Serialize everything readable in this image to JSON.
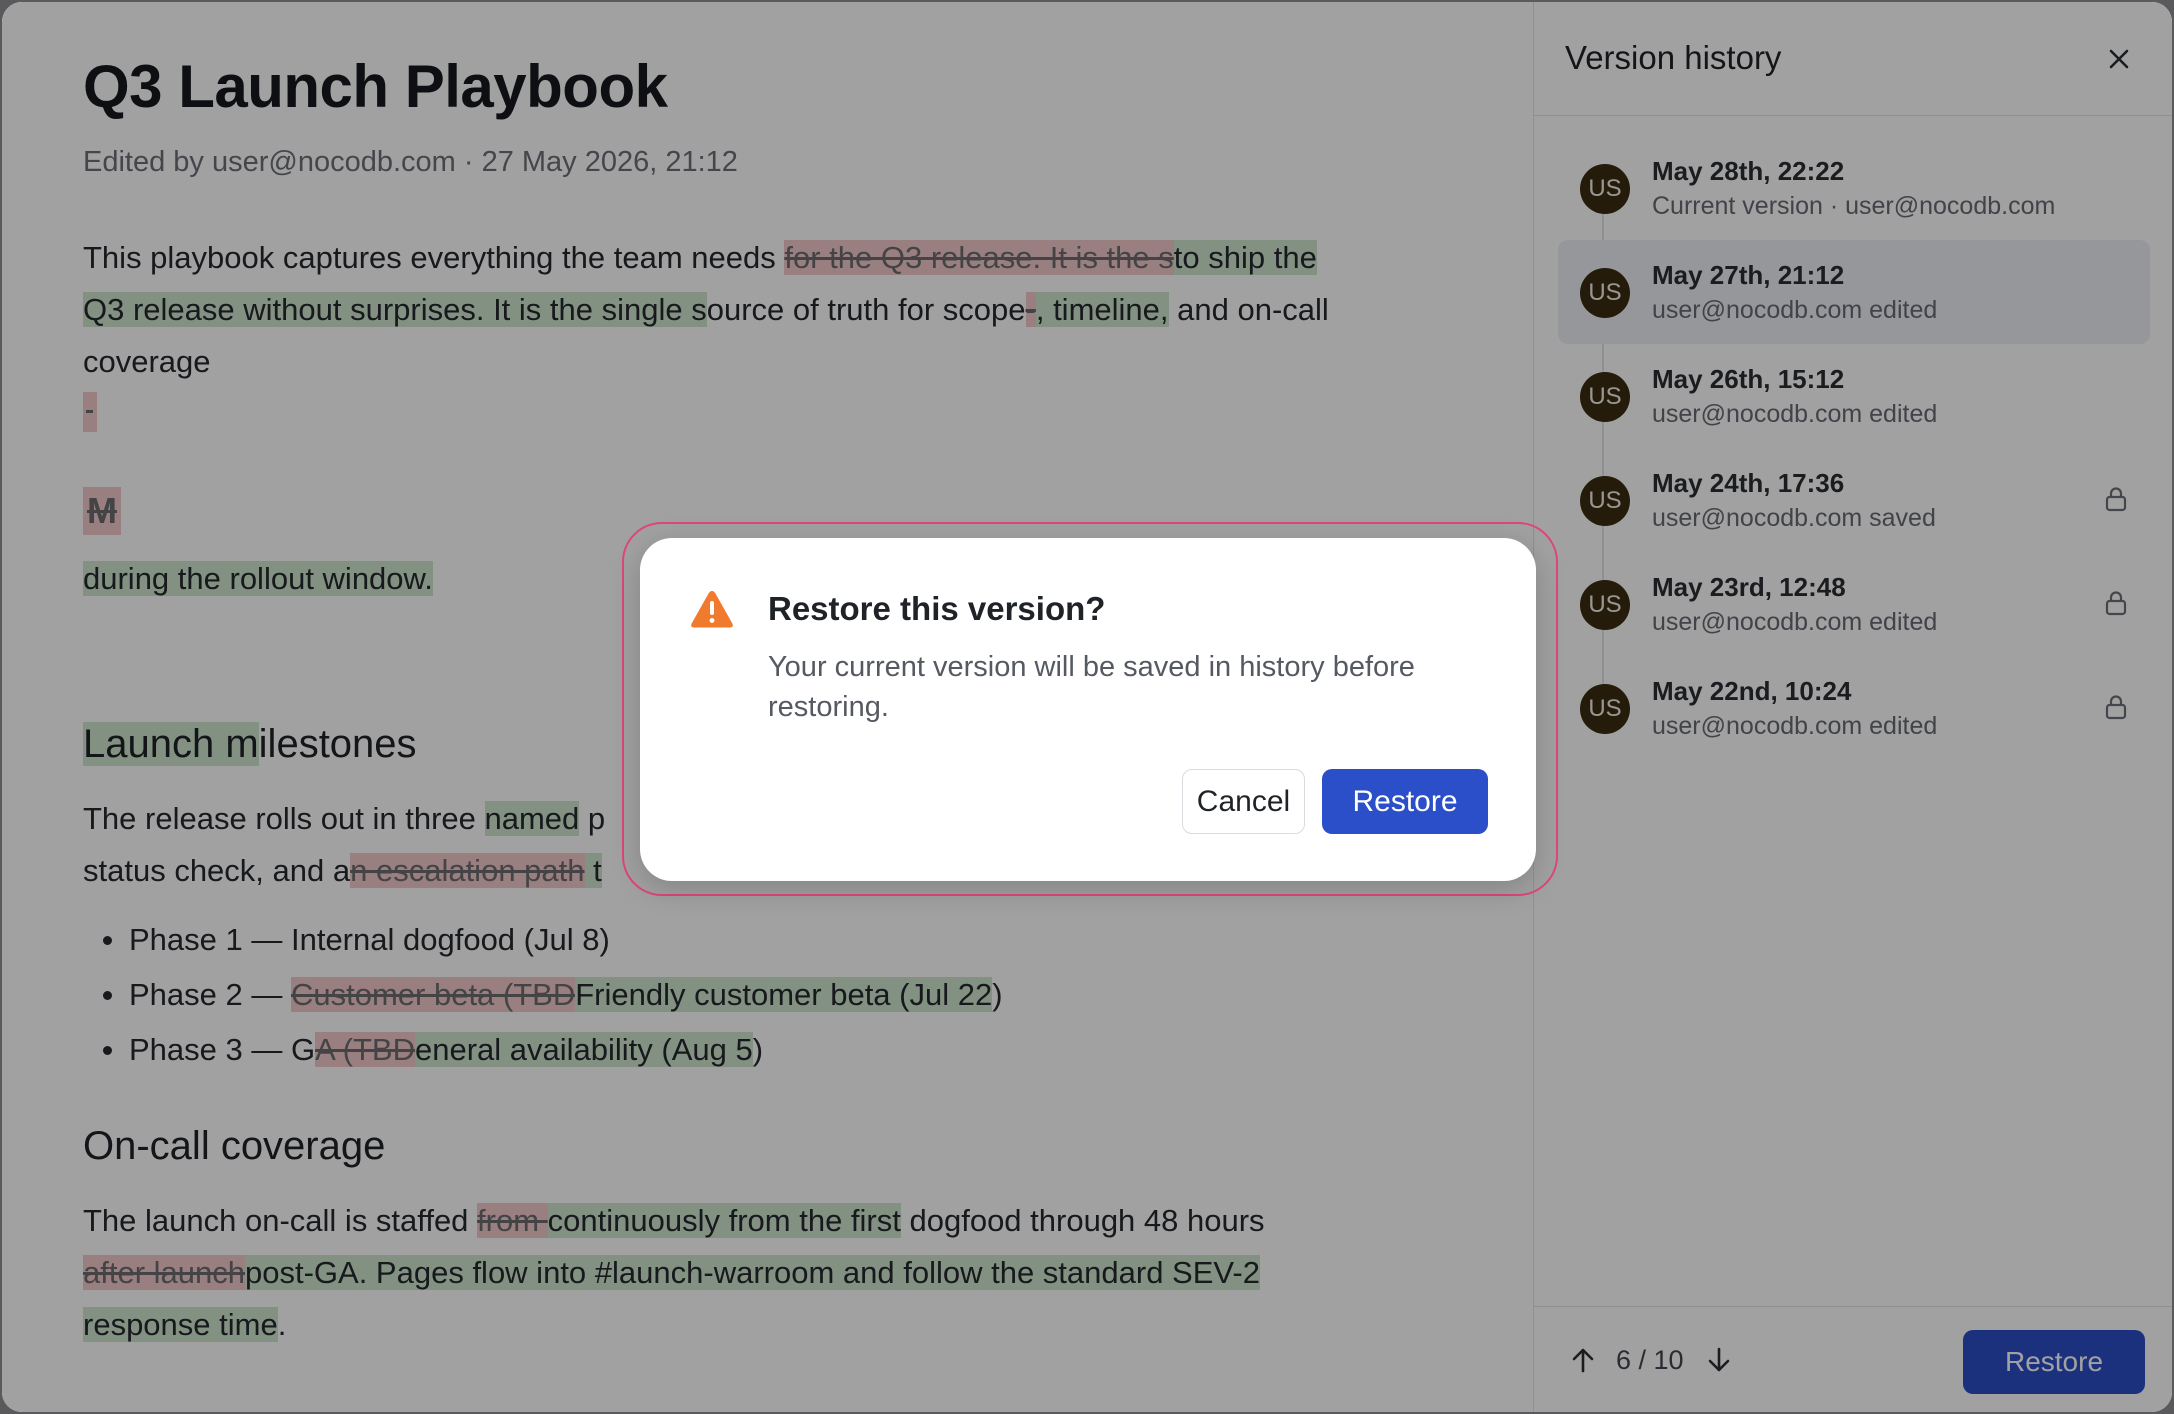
{
  "document": {
    "title": "Q3 Launch Playbook",
    "meta": "Edited by user@nocodb.com · 27 May 2026, 21:12",
    "intro": {
      "l1_a": "This playbook captures everything the team needs ",
      "l1_del": "for the Q3 release. It is the s",
      "l1_ins": "to ship the",
      "l2_ins": "Q3 release without surprises. It is the single s",
      "l2_b": "ource of truth for scope",
      "l2_del": "-",
      "l2_ins2": ", timeline,",
      "l2_c": " and on-call",
      "l3": "coverage"
    },
    "deleted_heading": "M",
    "rollout_line": " during the rollout window.",
    "milestones_heading_ins": "Launch m",
    "milestones_heading_rest": "ilestones",
    "milestones_para": {
      "l1_a": "The release rolls out in three ",
      "l1_ins": "named",
      "l1_b": " p",
      "l2_a": "status check, and a",
      "l2_del": "n escalation path",
      "l2_b": " t"
    },
    "phases": [
      {
        "prefix": "Phase 1 — Internal dogfood (Jul 8)",
        "del": "",
        "ins": "",
        "suffix": ""
      },
      {
        "prefix": "Phase 2 — ",
        "del": "Customer beta (TBD",
        "ins": "Friendly customer beta (Jul 22",
        "suffix": ")"
      },
      {
        "prefix": "Phase 3 — G",
        "del": "A (TBD",
        "ins": "eneral availability (Aug 5",
        "suffix": ")"
      }
    ],
    "oncall_heading": "On-call coverage",
    "oncall_para": {
      "l1_a": "The launch on-call is staffed ",
      "l1_del": "from ",
      "l1_ins": "continuously from the first",
      "l1_b": " dogfood through 48 hours",
      "l2_del": "after launch",
      "l2_ins": "post-GA. Pages flow into #launch-warroom and follow the standard SEV-2",
      "l3_ins": "response time",
      "l3_b": "."
    }
  },
  "sidebar": {
    "title": "Version history",
    "versions": [
      {
        "date": "May 28th, 22:22",
        "sub": "Current version · user@nocodb.com",
        "avatar": "US",
        "locked": false
      },
      {
        "date": "May 27th, 21:12",
        "sub": "user@nocodb.com edited",
        "avatar": "US",
        "locked": false
      },
      {
        "date": "May 26th, 15:12",
        "sub": "user@nocodb.com edited",
        "avatar": "US",
        "locked": false
      },
      {
        "date": "May 24th, 17:36",
        "sub": "user@nocodb.com saved",
        "avatar": "US",
        "locked": true
      },
      {
        "date": "May 23rd, 12:48",
        "sub": "user@nocodb.com edited",
        "avatar": "US",
        "locked": true
      },
      {
        "date": "May 22nd, 10:24",
        "sub": "user@nocodb.com edited",
        "avatar": "US",
        "locked": true
      }
    ],
    "footer": {
      "page": "6 / 10",
      "restore_label": "Restore"
    }
  },
  "dialog": {
    "title": "Restore this version?",
    "body": "Your current version will be saved in history before restoring.",
    "cancel_label": "Cancel",
    "restore_label": "Restore"
  },
  "colors": {
    "accent": "#2b4fc8",
    "inserted": "#cfe6cf",
    "deleted": "#f3c9c9",
    "warning": "#f07a2d",
    "focus_ring": "#e0447c"
  }
}
